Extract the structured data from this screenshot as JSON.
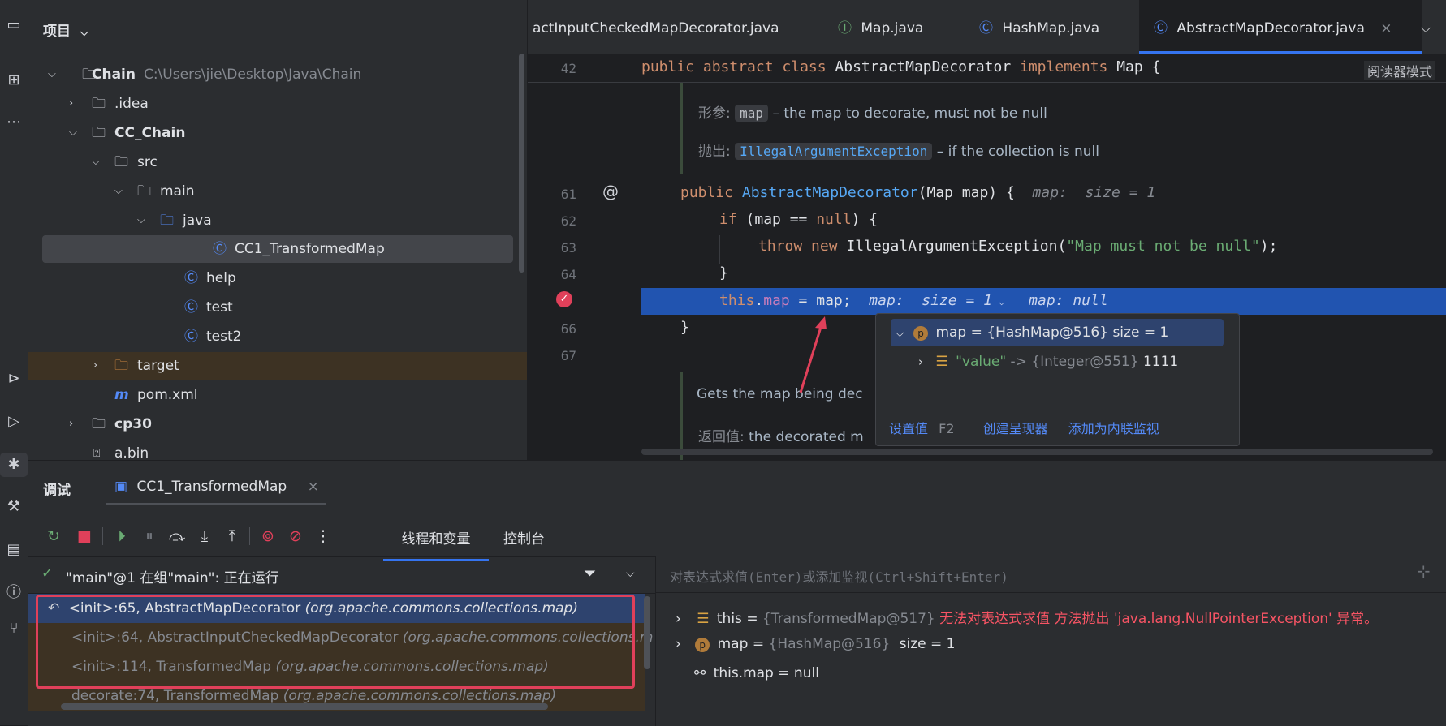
{
  "project_panel": {
    "title": "项目",
    "tree": [
      {
        "label": "Chain",
        "path": "C:\\Users\\jie\\Desktop\\Java\\Chain",
        "icon": "module-folder-icon",
        "expanded": true,
        "bold": true
      },
      {
        "label": ".idea",
        "icon": "folder-icon",
        "expanded": false
      },
      {
        "label": "CC_Chain",
        "icon": "module-folder-icon",
        "expanded": true,
        "bold": true
      },
      {
        "label": "src",
        "icon": "folder-icon",
        "expanded": true
      },
      {
        "label": "main",
        "icon": "folder-icon",
        "expanded": true
      },
      {
        "label": "java",
        "icon": "source-folder-icon",
        "expanded": true
      },
      {
        "label": "CC1_TransformedMap",
        "icon": "runnable-class-icon",
        "selected": true
      },
      {
        "label": "help",
        "icon": "class-icon"
      },
      {
        "label": "test",
        "icon": "runnable-class-icon"
      },
      {
        "label": "test2",
        "icon": "runnable-class-icon"
      },
      {
        "label": "target",
        "icon": "excluded-folder-icon",
        "expanded": false
      },
      {
        "label": "pom.xml",
        "icon": "maven-icon"
      },
      {
        "label": "cp30",
        "icon": "module-folder-icon",
        "expanded": false,
        "bold": true
      },
      {
        "label": "a.bin",
        "icon": "unknown-file-icon"
      }
    ]
  },
  "editor": {
    "tabs": [
      {
        "label": "actInputCheckedMapDecorator.java",
        "icon": ""
      },
      {
        "label": "Map.java",
        "icon": "interface-icon"
      },
      {
        "label": "HashMap.java",
        "icon": "class-icon"
      },
      {
        "label": "AbstractMapDecorator.java",
        "icon": "class-icon",
        "active": true,
        "close": "×"
      }
    ],
    "reader_mode": "阅读器模式",
    "lines": {
      "l42": "42",
      "l61": "61",
      "l62": "62",
      "l63": "63",
      "l64": "64",
      "l66": "66",
      "l67": "67"
    },
    "code": {
      "line42_kw1": "public abstract class ",
      "line42_name": "AbstractMapDecorator ",
      "line42_kw2": "implements ",
      "line42_rest": "Map {",
      "doc_param_label": "形参:",
      "doc_param_chip": "map",
      "doc_param_text": "– the map to decorate, must not be null",
      "doc_throws_label": "抛出:",
      "doc_throws_chip": "IllegalArgumentException",
      "doc_throws_text": "– if the collection is null",
      "line61_kw": "public ",
      "line61_fn": "AbstractMapDecorator",
      "line61_rest": "(Map map) {",
      "line61_hint": "map:  size = 1",
      "line62_kw": "if ",
      "line62_rest": "(map == ",
      "line62_null": "null",
      "line62_end": ") {",
      "line63_kw": "throw new ",
      "line63_rest": "IllegalArgumentException(",
      "line63_str": "\"Map must not be null\"",
      "line63_end": ");",
      "line64": "}",
      "line65_this": "this",
      "line65_dot": ".",
      "line65_field": "map",
      "line65_rest": " = map;",
      "line65_hint1": "map:  size = 1",
      "line65_hint2": "map: null",
      "line66": "}",
      "doc_get_text": "Gets the map being dec",
      "doc_return_label": "返回值:",
      "doc_return_text": "the decorated m"
    }
  },
  "popup": {
    "row1": "map = {HashMap@516}  size = 1",
    "row2_key": "\"value\"",
    "row2_arrow": " -> ",
    "row2_type": "{Integer@551}",
    "row2_val": " 1111",
    "set_value": "设置值",
    "set_value_key": "F2",
    "create_renderer": "创建呈现器",
    "add_inline_watch": "添加为内联监视"
  },
  "debug": {
    "title": "调试",
    "session_tab": "CC1_TransformedMap",
    "session_close": "×",
    "tab_threads": "线程和变量",
    "tab_console": "控制台",
    "thread_status": "\"main\"@1 在组\"main\": 正在运行",
    "eval_placeholder": "对表达式求值(Enter)或添加监视(Ctrl+Shift+Enter)",
    "frames": [
      {
        "method": "<init>:65, AbstractMapDecorator",
        "pkg": "(org.apache.commons.collections.map)"
      },
      {
        "method": "<init>:64, AbstractInputCheckedMapDecorator",
        "pkg": "(org.apache.commons.collections.m"
      },
      {
        "method": "<init>:114, TransformedMap",
        "pkg": "(org.apache.commons.collections.map)"
      },
      {
        "method": "decorate:74, TransformedMap",
        "pkg": "(org.apache.commons.collections.map)"
      }
    ],
    "variables": [
      {
        "name": "this",
        "type": "{TransformedMap@517}",
        "error": "无法对表达式求值 方法抛出 'java.lang.NullPointerException' 异常。"
      },
      {
        "name": "map",
        "type": "{HashMap@516}",
        "value": "size = 1"
      },
      {
        "name": "this.map",
        "value": "null"
      }
    ]
  },
  "colors": {
    "accent": "#3574f0",
    "highlight_line": "#2154b0",
    "error_text": "#f75464",
    "annotation_red": "#e0405a"
  }
}
